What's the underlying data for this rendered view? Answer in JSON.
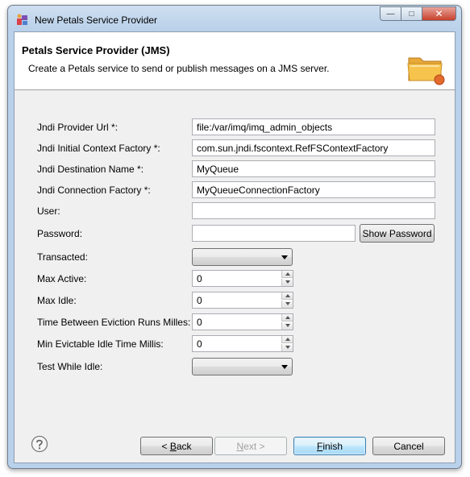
{
  "window": {
    "title": "New Petals Service Provider",
    "min_glyph": "—",
    "max_glyph": "□",
    "close_glyph": "✕"
  },
  "header": {
    "title": "Petals Service Provider (JMS)",
    "description": "Create a Petals service to send or publish messages on a JMS server."
  },
  "form": {
    "jndi_provider_url": {
      "label": "Jndi Provider Url *:",
      "value": "file:/var/imq/imq_admin_objects"
    },
    "jndi_initial_context_factory": {
      "label": "Jndi Initial Context Factory *:",
      "value": "com.sun.jndi.fscontext.RefFSContextFactory"
    },
    "jndi_destination_name": {
      "label": "Jndi Destination Name *:",
      "value": "MyQueue"
    },
    "jndi_connection_factory": {
      "label": "Jndi Connection Factory *:",
      "value": "MyQueueConnectionFactory"
    },
    "user": {
      "label": "User:",
      "value": ""
    },
    "password": {
      "label": "Password:",
      "value": ""
    },
    "show_password_label": "Show Password",
    "transacted": {
      "label": "Transacted:",
      "value": ""
    },
    "max_active": {
      "label": "Max Active:",
      "value": "0"
    },
    "max_idle": {
      "label": "Max Idle:",
      "value": "0"
    },
    "time_between_eviction": {
      "label": "Time Between Eviction Runs Milles:",
      "value": "0"
    },
    "min_evictable_idle": {
      "label": "Min Evictable Idle Time Millis:",
      "value": "0"
    },
    "test_while_idle": {
      "label": "Test While Idle:",
      "value": ""
    }
  },
  "footer": {
    "back_label_prefix": "< ",
    "back_label_mnemonic": "B",
    "back_label_rest": "ack",
    "next_label_mnemonic": "N",
    "next_label_rest": "ext >",
    "finish_label_mnemonic": "F",
    "finish_label_rest": "inish",
    "cancel_label": "Cancel"
  },
  "icons": {
    "app": "petals-app-icon",
    "header": "folder-icon",
    "help": "help-icon"
  },
  "colors": {
    "title_bar": "#b9d1ea",
    "close_button": "#c7402c",
    "default_button": "#3c7fb1",
    "folder": "#f6c34d"
  }
}
